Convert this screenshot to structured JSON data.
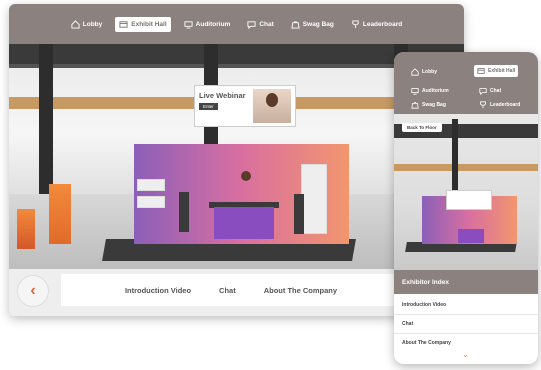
{
  "desktop": {
    "nav": [
      {
        "label": "Lobby",
        "icon": "home-icon",
        "active": false
      },
      {
        "label": "Exhibit Hall",
        "icon": "exhibit-hall-icon",
        "active": true
      },
      {
        "label": "Auditorium",
        "icon": "monitor-icon",
        "active": false
      },
      {
        "label": "Chat",
        "icon": "chat-icon",
        "active": false
      },
      {
        "label": "Swag Bag",
        "icon": "bag-icon",
        "active": false
      },
      {
        "label": "Leaderboard",
        "icon": "trophy-icon",
        "active": false
      }
    ],
    "webinar": {
      "title": "Live Webinar",
      "button": "Enter"
    },
    "info_links": [
      "Introduction Video",
      "Chat",
      "About The Company"
    ],
    "back_icon": "back-arrow-icon"
  },
  "mobile": {
    "nav": [
      {
        "label": "Lobby",
        "icon": "home-icon",
        "active": false
      },
      {
        "label": "Exhibit Hall",
        "icon": "exhibit-hall-icon",
        "active": true
      },
      {
        "label": "Auditorium",
        "icon": "monitor-icon",
        "active": false
      },
      {
        "label": "Chat",
        "icon": "chat-icon",
        "active": false
      },
      {
        "label": "Swag Bag",
        "icon": "bag-icon",
        "active": false
      },
      {
        "label": "Leaderboard",
        "icon": "trophy-icon",
        "active": false
      }
    ],
    "back_to_floor": "Back To Floor",
    "exhibitor_index": "Exhibitor Index",
    "links": [
      "Introduction Video",
      "Chat",
      "About The Company"
    ]
  },
  "colors": {
    "nav_bg": "#8b8280",
    "accent": "#e06030"
  }
}
